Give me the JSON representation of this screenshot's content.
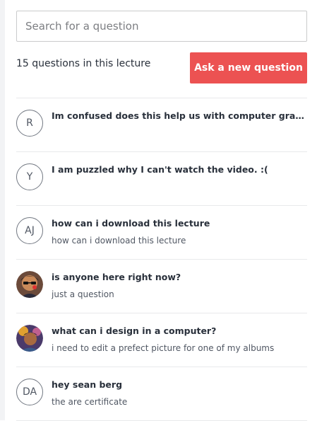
{
  "search": {
    "placeholder": "Search for a question"
  },
  "header": {
    "count_text": "15 questions in this lecture",
    "ask_label": "Ask a new question"
  },
  "questions": [
    {
      "avatar_initials": "R",
      "title": "Im confused does this help us with computer graphic ...",
      "body": ""
    },
    {
      "avatar_initials": "Y",
      "title": "I am puzzled why I can't watch the video. :(",
      "body": ""
    },
    {
      "avatar_initials": "AJ",
      "title": "how can i download this lecture",
      "body": "how can i download this lecture"
    },
    {
      "avatar_initials": "",
      "title": "is anyone here right now?",
      "body": "just a question"
    },
    {
      "avatar_initials": "",
      "title": "what can i design in a computer?",
      "body": "i need to edit a prefect picture for one of my albums"
    },
    {
      "avatar_initials": "DA",
      "title": "hey sean berg",
      "body": "the are certificate"
    }
  ]
}
